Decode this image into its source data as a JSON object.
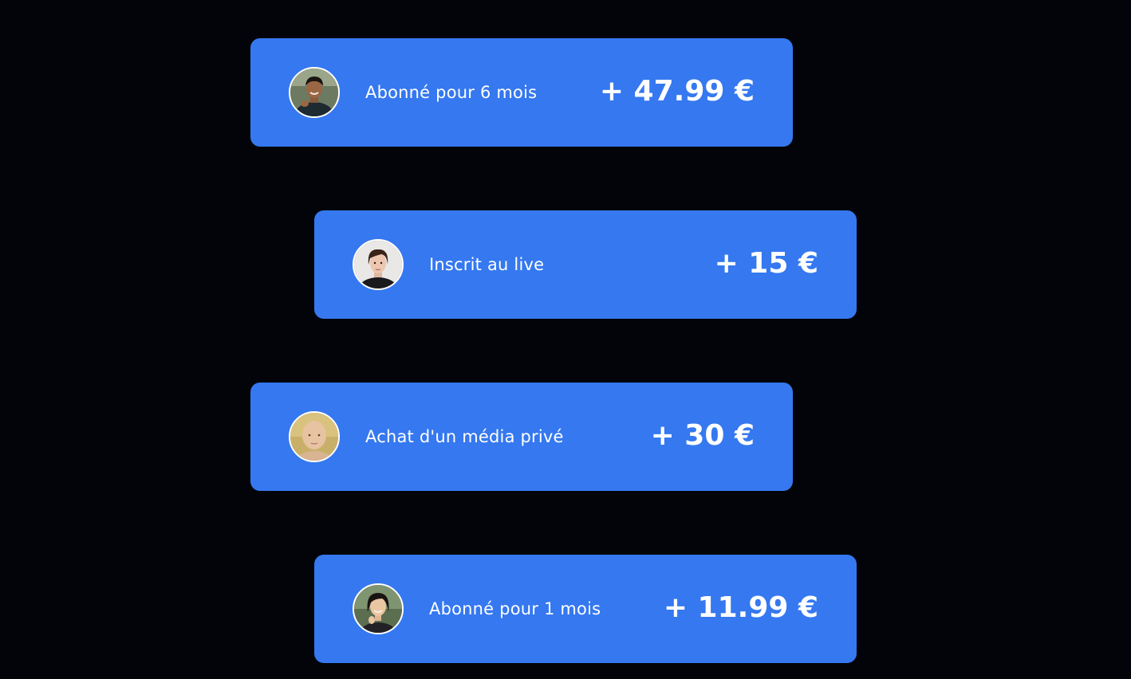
{
  "colors": {
    "background": "#03040a",
    "card": "#3578f0",
    "text": "#ffffff"
  },
  "transactions": [
    {
      "label": "Abonné pour 6 mois",
      "amount": "+ 47.99 €",
      "avatar": "avatar-man-smiling"
    },
    {
      "label": "Inscrit au live",
      "amount": "+ 15 €",
      "avatar": "avatar-person-short-hair"
    },
    {
      "label": "Achat d'un média privé",
      "amount": "+ 30 €",
      "avatar": "avatar-bald-child"
    },
    {
      "label": "Abonné pour 1 mois",
      "amount": "+ 11.99 €",
      "avatar": "avatar-woman-smiling"
    }
  ]
}
